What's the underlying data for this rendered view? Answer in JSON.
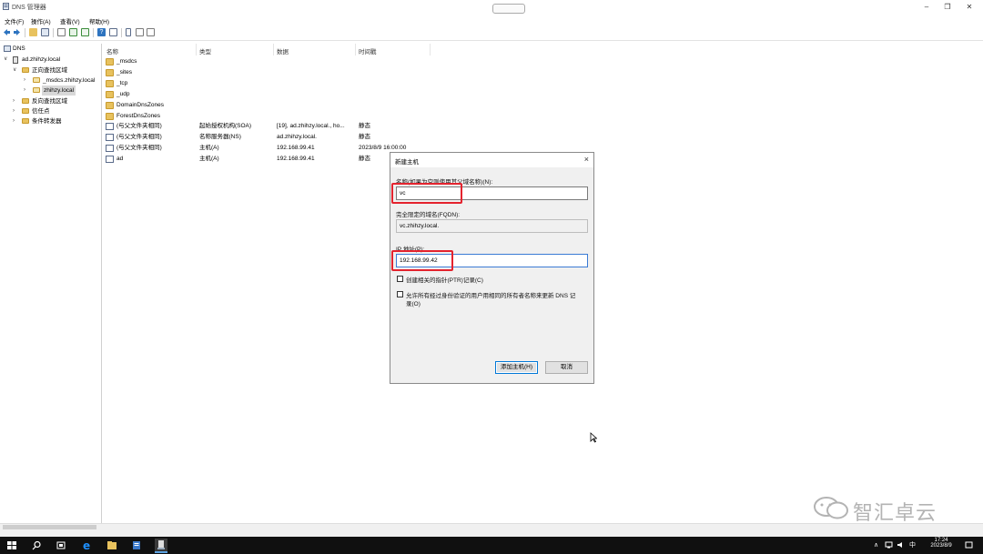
{
  "window": {
    "title": "DNS 管理器"
  },
  "menu": [
    "文件(F)",
    "操作(A)",
    "查看(V)",
    "帮助(H)"
  ],
  "tree": {
    "root": "DNS",
    "server": "ad.zhihzy.local",
    "forward_zone": "正向查找区域",
    "msdcs_zone": "_msdcs.zhihzy.local",
    "selected_zone": "zhihzy.local",
    "reverse_zone": "反向查找区域",
    "trust_points": "信任点",
    "conditional_forwarders": "条件转发器"
  },
  "list": {
    "columns": [
      "名称",
      "类型",
      "数据",
      "时间戳"
    ],
    "rows": [
      {
        "icon": "folder-icon",
        "name": "_msdcs",
        "type": "",
        "data": "",
        "time": ""
      },
      {
        "icon": "folder-icon",
        "name": "_sites",
        "type": "",
        "data": "",
        "time": ""
      },
      {
        "icon": "folder-icon",
        "name": "_tcp",
        "type": "",
        "data": "",
        "time": ""
      },
      {
        "icon": "folder-icon",
        "name": "_udp",
        "type": "",
        "data": "",
        "time": ""
      },
      {
        "icon": "folder-icon",
        "name": "DomainDnsZones",
        "type": "",
        "data": "",
        "time": ""
      },
      {
        "icon": "folder-icon",
        "name": "ForestDnsZones",
        "type": "",
        "data": "",
        "time": ""
      },
      {
        "icon": "record-icon",
        "name": "(与父文件夹相同)",
        "type": "起始授权机构(SOA)",
        "data": "[19], ad.zhihzy.local., ho...",
        "time": "静态"
      },
      {
        "icon": "record-icon",
        "name": "(与父文件夹相同)",
        "type": "名称服务器(NS)",
        "data": "ad.zhihzy.local.",
        "time": "静态"
      },
      {
        "icon": "record-icon",
        "name": "(与父文件夹相同)",
        "type": "主机(A)",
        "data": "192.168.99.41",
        "time": "2023/8/9 16:00:00"
      },
      {
        "icon": "record-icon",
        "name": "ad",
        "type": "主机(A)",
        "data": "192.168.99.41",
        "time": "静态"
      }
    ]
  },
  "dialog": {
    "title": "新建主机",
    "close": "×",
    "name_label": "名称(如果为空则使用其父域名称)(N):",
    "name_value": "vc",
    "fqdn_label": "完全限定的域名(FQDN):",
    "fqdn_value": "vc.zhihzy.local.",
    "ip_label": "IP 地址(P):",
    "ip_value": "192.168.99.42",
    "ptr_checkbox": "创建相关的指针(PTR)记录(C)",
    "ptr_checked": false,
    "allow_checkbox_line1": "允许所有经过身份验证的用户用相同的所有者名称来更新 DNS 记",
    "allow_checkbox_line2": "录(O)",
    "allow_checked": false,
    "add_button": "添加主机(H)",
    "cancel_button": "取消"
  },
  "taskbar": {
    "time": "17:24",
    "date": "2023/8/9",
    "ime": "中"
  },
  "watermark": {
    "text": "智汇卓云"
  }
}
